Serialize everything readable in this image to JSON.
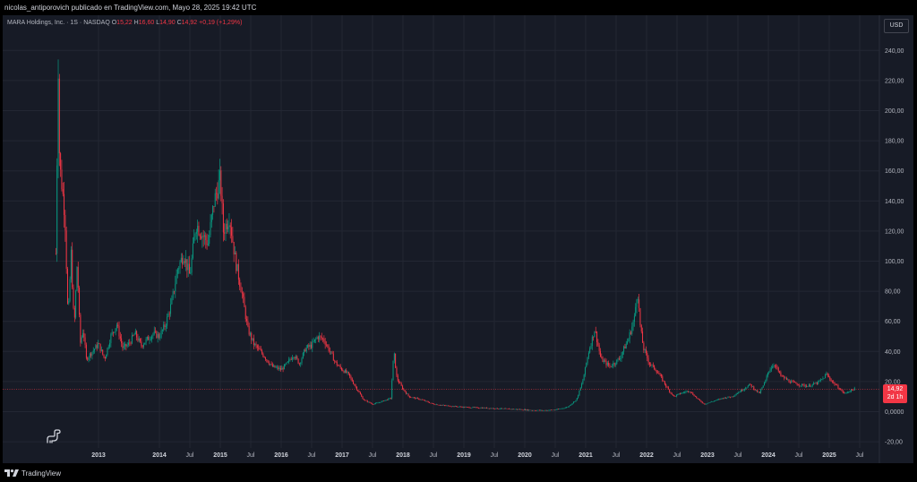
{
  "header": {
    "publisher_line": "nicolas_antiporovich publicado en TradingView.com, Mayo 28, 2025 19:42 UTC"
  },
  "legend": {
    "symbol": "MARA Holdings, Inc. · 1S · NASDAQ",
    "o_label": "O",
    "o_value": "15,22",
    "h_label": "H",
    "h_value": "16,60",
    "l_label": "L",
    "l_value": "14,90",
    "c_label": "C",
    "c_value": "14,92",
    "change": "+0,19 (+1,29%)"
  },
  "currency_button": "USD",
  "price_badge": {
    "price": "14,92",
    "countdown": "2d 1h"
  },
  "footer": {
    "brand": "TradingView"
  },
  "colors": {
    "up": "#089981",
    "down": "#f23645",
    "background": "#171b26",
    "grid": "#232733"
  },
  "icons": [
    "dino-icon",
    "tradingview-logo-icon"
  ],
  "chart_data": {
    "type": "candlestick",
    "interval": "1S",
    "ylim": [
      -20,
      250
    ],
    "y_ticks": [
      "-20,00",
      "0,0000",
      "20,00",
      "40,00",
      "60,00",
      "80,00",
      "100,00",
      "120,00",
      "140,00",
      "160,00",
      "180,00",
      "200,00",
      "220,00",
      "240,00"
    ],
    "y_tick_values": [
      -20,
      0,
      20,
      40,
      60,
      80,
      100,
      120,
      140,
      160,
      180,
      200,
      220,
      240
    ],
    "x_ticks": [
      "2013",
      "2014",
      "Jul",
      "2015",
      "Jul",
      "2016",
      "Jul",
      "2017",
      "Jul",
      "2018",
      "Jul",
      "2019",
      "Jul",
      "2020",
      "Jul",
      "2021",
      "Jul",
      "2022",
      "Jul",
      "2023",
      "Jul",
      "2024",
      "Jul",
      "2025",
      "Jul"
    ],
    "x_tick_dates": [
      2013.0,
      2014.0,
      2014.5,
      2015.0,
      2015.5,
      2016.0,
      2016.5,
      2017.0,
      2017.5,
      2018.0,
      2018.5,
      2019.0,
      2019.5,
      2020.0,
      2020.5,
      2021.0,
      2021.5,
      2022.0,
      2022.5,
      2023.0,
      2023.5,
      2024.0,
      2024.5,
      2025.0,
      2025.5
    ],
    "last_close": 14.92,
    "price_path": [
      [
        2012.3,
        105
      ],
      [
        2012.34,
        235
      ],
      [
        2012.36,
        165
      ],
      [
        2012.4,
        150
      ],
      [
        2012.45,
        130
      ],
      [
        2012.5,
        60
      ],
      [
        2012.55,
        105
      ],
      [
        2012.6,
        55
      ],
      [
        2012.65,
        100
      ],
      [
        2012.7,
        45
      ],
      [
        2012.75,
        55
      ],
      [
        2012.8,
        35
      ],
      [
        2012.9,
        40
      ],
      [
        2013.0,
        45
      ],
      [
        2013.1,
        35
      ],
      [
        2013.2,
        50
      ],
      [
        2013.3,
        58
      ],
      [
        2013.4,
        42
      ],
      [
        2013.5,
        45
      ],
      [
        2013.6,
        52
      ],
      [
        2013.7,
        44
      ],
      [
        2013.8,
        48
      ],
      [
        2013.9,
        52
      ],
      [
        2014.0,
        50
      ],
      [
        2014.1,
        58
      ],
      [
        2014.2,
        72
      ],
      [
        2014.3,
        95
      ],
      [
        2014.4,
        105
      ],
      [
        2014.5,
        90
      ],
      [
        2014.6,
        125
      ],
      [
        2014.7,
        118
      ],
      [
        2014.8,
        112
      ],
      [
        2014.9,
        140
      ],
      [
        2015.0,
        155
      ],
      [
        2015.05,
        120
      ],
      [
        2015.15,
        130
      ],
      [
        2015.25,
        100
      ],
      [
        2015.35,
        80
      ],
      [
        2015.45,
        55
      ],
      [
        2015.55,
        45
      ],
      [
        2015.7,
        38
      ],
      [
        2015.85,
        30
      ],
      [
        2016.0,
        28
      ],
      [
        2016.1,
        32
      ],
      [
        2016.2,
        38
      ],
      [
        2016.3,
        32
      ],
      [
        2016.4,
        42
      ],
      [
        2016.5,
        44
      ],
      [
        2016.6,
        50
      ],
      [
        2016.7,
        48
      ],
      [
        2016.8,
        40
      ],
      [
        2016.9,
        32
      ],
      [
        2017.0,
        28
      ],
      [
        2017.1,
        25
      ],
      [
        2017.2,
        18
      ],
      [
        2017.35,
        8
      ],
      [
        2017.5,
        5
      ],
      [
        2017.6,
        6
      ],
      [
        2017.8,
        9
      ],
      [
        2017.85,
        40
      ],
      [
        2017.9,
        22
      ],
      [
        2018.0,
        15
      ],
      [
        2018.1,
        10
      ],
      [
        2018.3,
        8
      ],
      [
        2018.5,
        5
      ],
      [
        2018.7,
        4
      ],
      [
        2019.0,
        3
      ],
      [
        2019.3,
        2.5
      ],
      [
        2019.6,
        2
      ],
      [
        2019.9,
        1.5
      ],
      [
        2020.1,
        1
      ],
      [
        2020.3,
        0.8
      ],
      [
        2020.5,
        1.2
      ],
      [
        2020.7,
        3
      ],
      [
        2020.85,
        8
      ],
      [
        2020.95,
        20
      ],
      [
        2021.05,
        40
      ],
      [
        2021.15,
        55
      ],
      [
        2021.25,
        35
      ],
      [
        2021.4,
        30
      ],
      [
        2021.55,
        35
      ],
      [
        2021.7,
        48
      ],
      [
        2021.8,
        62
      ],
      [
        2021.85,
        82
      ],
      [
        2021.9,
        55
      ],
      [
        2021.95,
        42
      ],
      [
        2022.05,
        32
      ],
      [
        2022.15,
        28
      ],
      [
        2022.25,
        22
      ],
      [
        2022.35,
        15
      ],
      [
        2022.45,
        10
      ],
      [
        2022.55,
        12
      ],
      [
        2022.7,
        14
      ],
      [
        2022.85,
        8
      ],
      [
        2022.95,
        5
      ],
      [
        2023.1,
        7
      ],
      [
        2023.25,
        9
      ],
      [
        2023.4,
        10
      ],
      [
        2023.55,
        14
      ],
      [
        2023.7,
        18
      ],
      [
        2023.85,
        12
      ],
      [
        2023.95,
        20
      ],
      [
        2024.0,
        27
      ],
      [
        2024.1,
        32
      ],
      [
        2024.2,
        24
      ],
      [
        2024.35,
        20
      ],
      [
        2024.5,
        18
      ],
      [
        2024.65,
        17
      ],
      [
        2024.8,
        19
      ],
      [
        2024.9,
        22
      ],
      [
        2024.95,
        25
      ],
      [
        2025.05,
        20
      ],
      [
        2025.15,
        16
      ],
      [
        2025.25,
        12
      ],
      [
        2025.35,
        14
      ],
      [
        2025.42,
        15.2
      ]
    ]
  }
}
